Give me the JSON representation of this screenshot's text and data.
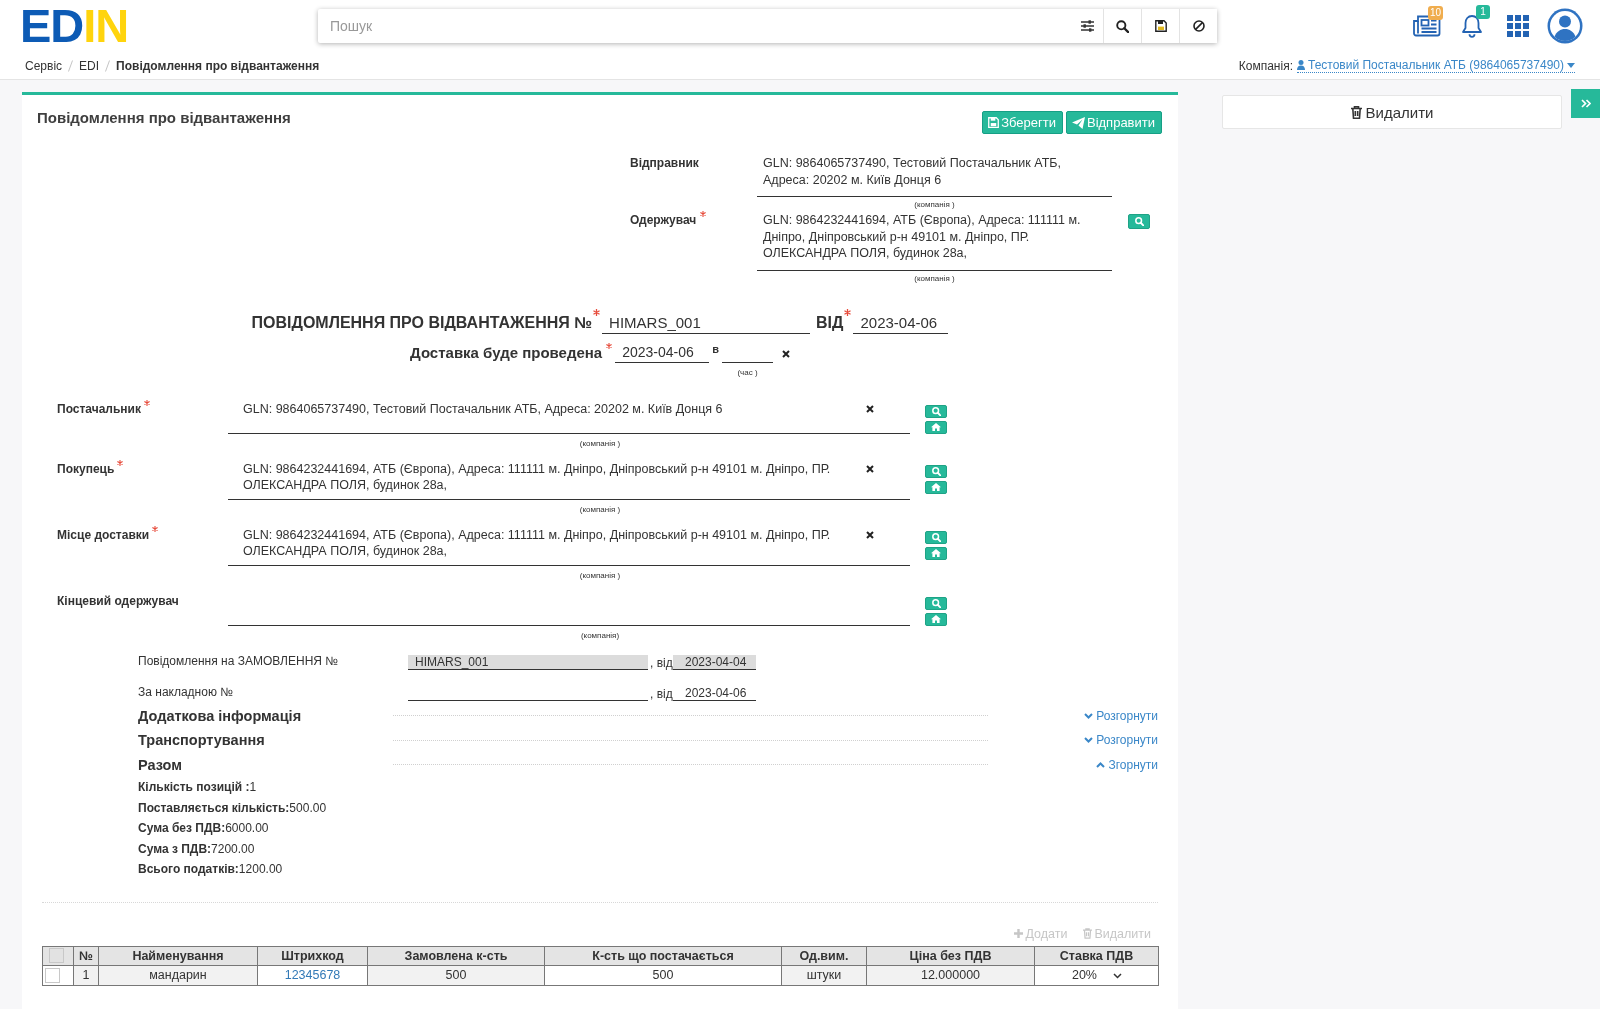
{
  "header": {
    "logo": [
      "ED",
      "IN"
    ],
    "search": {
      "placeholder": "Пошук"
    },
    "notifications": [
      {
        "kind": "news",
        "badge": "10",
        "color": "#f0ad4e"
      },
      {
        "kind": "bell",
        "badge": "1",
        "color": "#26b99a"
      }
    ]
  },
  "breadcrumbs": [
    {
      "label": "Сервіс",
      "current": false
    },
    {
      "label": "EDI",
      "current": false
    },
    {
      "label": "Повідомлення про відвантаження",
      "current": true
    }
  ],
  "company": {
    "label": "Компанія:",
    "value": "Тестовий Постачальник АТБ (9864065737490)"
  },
  "document": {
    "title": "Повідомлення про відвантаження",
    "actions": [
      {
        "kind": "save",
        "label": "Зберегти"
      },
      {
        "kind": "send",
        "label": "Відправити"
      }
    ],
    "routing": [
      {
        "label": "Відправник",
        "required": false,
        "search": false,
        "value": "GLN: 9864065737490, Тестовий Постачальник АТБ, Адреса: 20202 м. Київ Донця 6",
        "caption": "(компанія )"
      },
      {
        "label": "Одержувач",
        "required": true,
        "search": true,
        "value": "GLN: 9864232441694, АТБ (Європа), Адреса: 111111 м. Дніпро, Дніпровський р-н 49101 м. Дніпро, ПР. ОЛЕКСАНДРА ПОЛЯ, будинок 28а,",
        "caption": "(компанія )"
      }
    ],
    "heading": {
      "label": "ПОВІДОМЛЕННЯ ПРО ВІДВАНТАЖЕННЯ №",
      "required": true,
      "number": "HIMARS_001",
      "date_label": "ВІД",
      "date_required": true,
      "date": "2023-04-06"
    },
    "delivery": {
      "label": "Доставка буде проведена",
      "required": true,
      "date": "2023-04-06",
      "time_label": "в",
      "time_caption": "(час )"
    },
    "parties": [
      {
        "label": "Постачальник",
        "required": true,
        "value": "GLN: 9864065737490, Тестовий Постачальник АТБ, Адреса: 20202 м. Київ Донця 6",
        "caption": "(компанія )"
      },
      {
        "label": "Покупець",
        "required": true,
        "value": "GLN: 9864232441694, АТБ (Європа), Адреса: 111111 м. Дніпро, Дніпровський р-н 49101 м. Дніпро, ПР. ОЛЕКСАНДРА ПОЛЯ, будинок 28а,",
        "caption": "(компанія )"
      },
      {
        "label": "Місце доставки",
        "required": true,
        "value": "GLN: 9864232441694, АТБ (Європа), Адреса: 111111 м. Дніпро, Дніпровський р-н 49101 м. Дніпро, ПР. ОЛЕКСАНДРА ПОЛЯ, будинок 28а,",
        "caption": "(компанія )"
      },
      {
        "label": "Кінцевий одержувач",
        "required": false,
        "caption": "(компанія)"
      }
    ],
    "references": [
      {
        "label": "Повідомлення на ЗАМОВЛЕННЯ №",
        "readonly": true,
        "number": "HIMARS_001",
        "date_label": ", від",
        "date": "2023-04-04"
      },
      {
        "label": "За накладною №",
        "readonly": false,
        "date_label": ", від",
        "date": "2023-04-06"
      }
    ],
    "sections": [
      {
        "title": "Додаткова інформація",
        "toggle": "Розгорнути",
        "expanded": false
      },
      {
        "title": "Транспортування",
        "toggle": "Розгорнути",
        "expanded": false
      },
      {
        "title": "Разом",
        "toggle": "Згорнути",
        "expanded": true,
        "items": [
          "**Кількість позицій :**1",
          "**Поставляється кількість:**500.00",
          "**Сума без ПДВ:**6000.00",
          "**Сума з ПДВ:**7200.00",
          "**Всього податків:**1200.00"
        ]
      }
    ],
    "table": {
      "actions": [
        {
          "kind": "add",
          "label": "Додати",
          "disabled": true
        },
        {
          "kind": "delete",
          "label": "Видалити",
          "disabled": true
        }
      ],
      "select_all": false,
      "columns": [
        "№",
        "Найменування",
        "Штрихкод",
        "Замовлена к-сть",
        "К-сть що постачається",
        "Од.вим.",
        "Ціна без ПДВ",
        "Ставка ПДВ"
      ],
      "rows": [
        {
          "selected": false,
          "cells": [
            {
              "kind": "readonly",
              "text": "1"
            },
            {
              "kind": "readonly",
              "text": "мандарин"
            },
            {
              "kind": "link",
              "text": "12345678"
            },
            {
              "kind": "readonly",
              "text": "500"
            },
            {
              "kind": "input",
              "text": "500"
            },
            {
              "kind": "readonly",
              "text": "штуки"
            },
            {
              "kind": "readonly",
              "text": "12.000000"
            },
            {
              "kind": "select",
              "text": "20%"
            }
          ]
        }
      ]
    }
  },
  "side_panel": {
    "delete_button": "Видалити"
  }
}
